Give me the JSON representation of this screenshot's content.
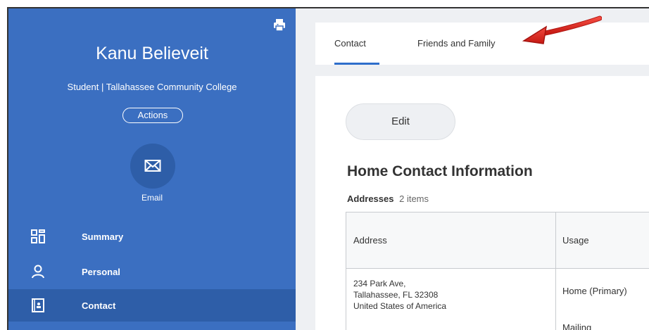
{
  "profile": {
    "name": "Kanu Believeit",
    "subtitle": "Student | Tallahassee Community College",
    "actions_label": "Actions",
    "email_label": "Email"
  },
  "icons": {
    "print": "print-icon",
    "email": "envelope-icon",
    "summary": "grid-icon",
    "personal": "person-icon",
    "contact": "contact-book-icon"
  },
  "nav": {
    "summary": "Summary",
    "personal": "Personal",
    "contact": "Contact"
  },
  "tabs": {
    "contact": "Contact",
    "friends": "Friends and Family"
  },
  "main": {
    "edit_label": "Edit",
    "section_title": "Home Contact Information",
    "addresses_label": "Addresses",
    "addresses_count": "2 items"
  },
  "table": {
    "headers": {
      "address": "Address",
      "usage": "Usage"
    },
    "rows": [
      {
        "address_line1": "234 Park Ave,",
        "address_line2": "Tallahassee, FL 32308",
        "address_line3": "United States of America",
        "usage_primary": "Home (Primary)",
        "usage_secondary": "Mailing"
      }
    ]
  },
  "colors": {
    "sidebar": "#3b6fc1",
    "sidebar_active": "#2e5ea8",
    "accent": "#2e6ecb",
    "arrow": "#e0201b"
  }
}
